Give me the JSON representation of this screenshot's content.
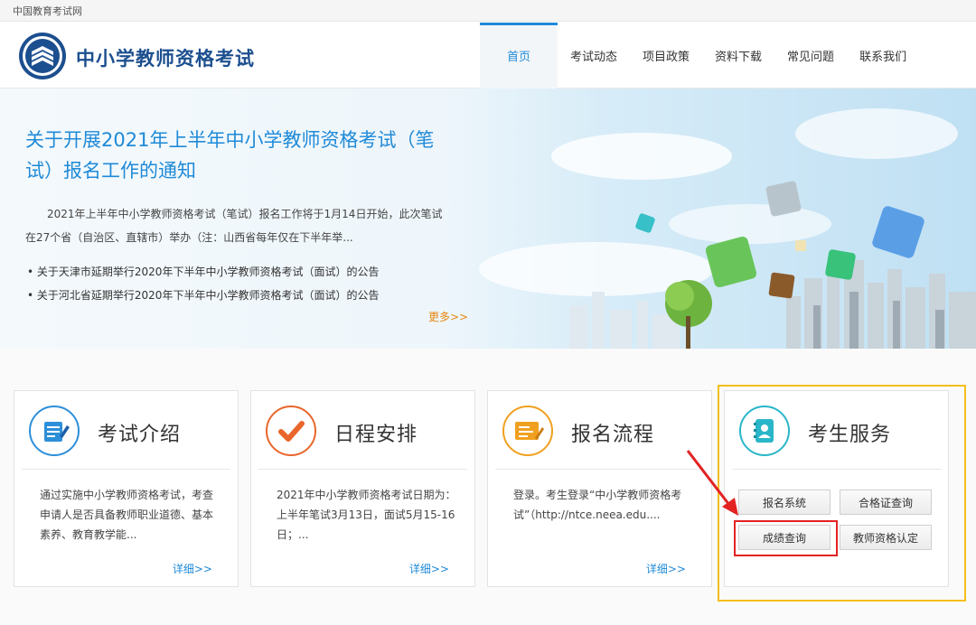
{
  "topbar": {
    "site_name": "中国教育考试网"
  },
  "header": {
    "title": "中小学教师资格考试",
    "nav": [
      "首页",
      "考试动态",
      "项目政策",
      "资料下载",
      "常见问题",
      "联系我们"
    ]
  },
  "banner": {
    "headline": "关于开展2021年上半年中小学教师资格考试（笔试）报名工作的通知",
    "summary": "2021年上半年中小学教师资格考试（笔试）报名工作将于1月14日开始，此次笔试在27个省（自治区、直辖市）举办（注：山西省每年仅在下半年举...",
    "news": [
      "关于天津市延期举行2020年下半年中小学教师资格考试（面试）的公告",
      "关于河北省延期举行2020年下半年中小学教师资格考试（面试）的公告"
    ],
    "more": "更多>>"
  },
  "cards": [
    {
      "title": "考试介绍",
      "text": "通过实施中小学教师资格考试，考查申请人是否具备教师职业道德、基本素养、教育教学能...",
      "more": "详细>>"
    },
    {
      "title": "日程安排",
      "text": "2021年中小学教师资格考试日期为：上半年笔试3月13日，面试5月15-16日；...",
      "more": "详细>>"
    },
    {
      "title": "报名流程",
      "text": "登录。考生登录“中小学教师资格考试”（http://ntce.neea.edu....",
      "more": "详细>>"
    },
    {
      "title": "考生服务"
    }
  ],
  "services": [
    "报名系统",
    "合格证查询",
    "成绩查询",
    "教师资格认定"
  ],
  "colors": {
    "brand_blue": "#1f8ad8",
    "title_blue": "#1c4f8f",
    "more_orange": "#e8860f",
    "highlight_yellow": "#f4be1c",
    "highlight_red": "#e32222"
  }
}
